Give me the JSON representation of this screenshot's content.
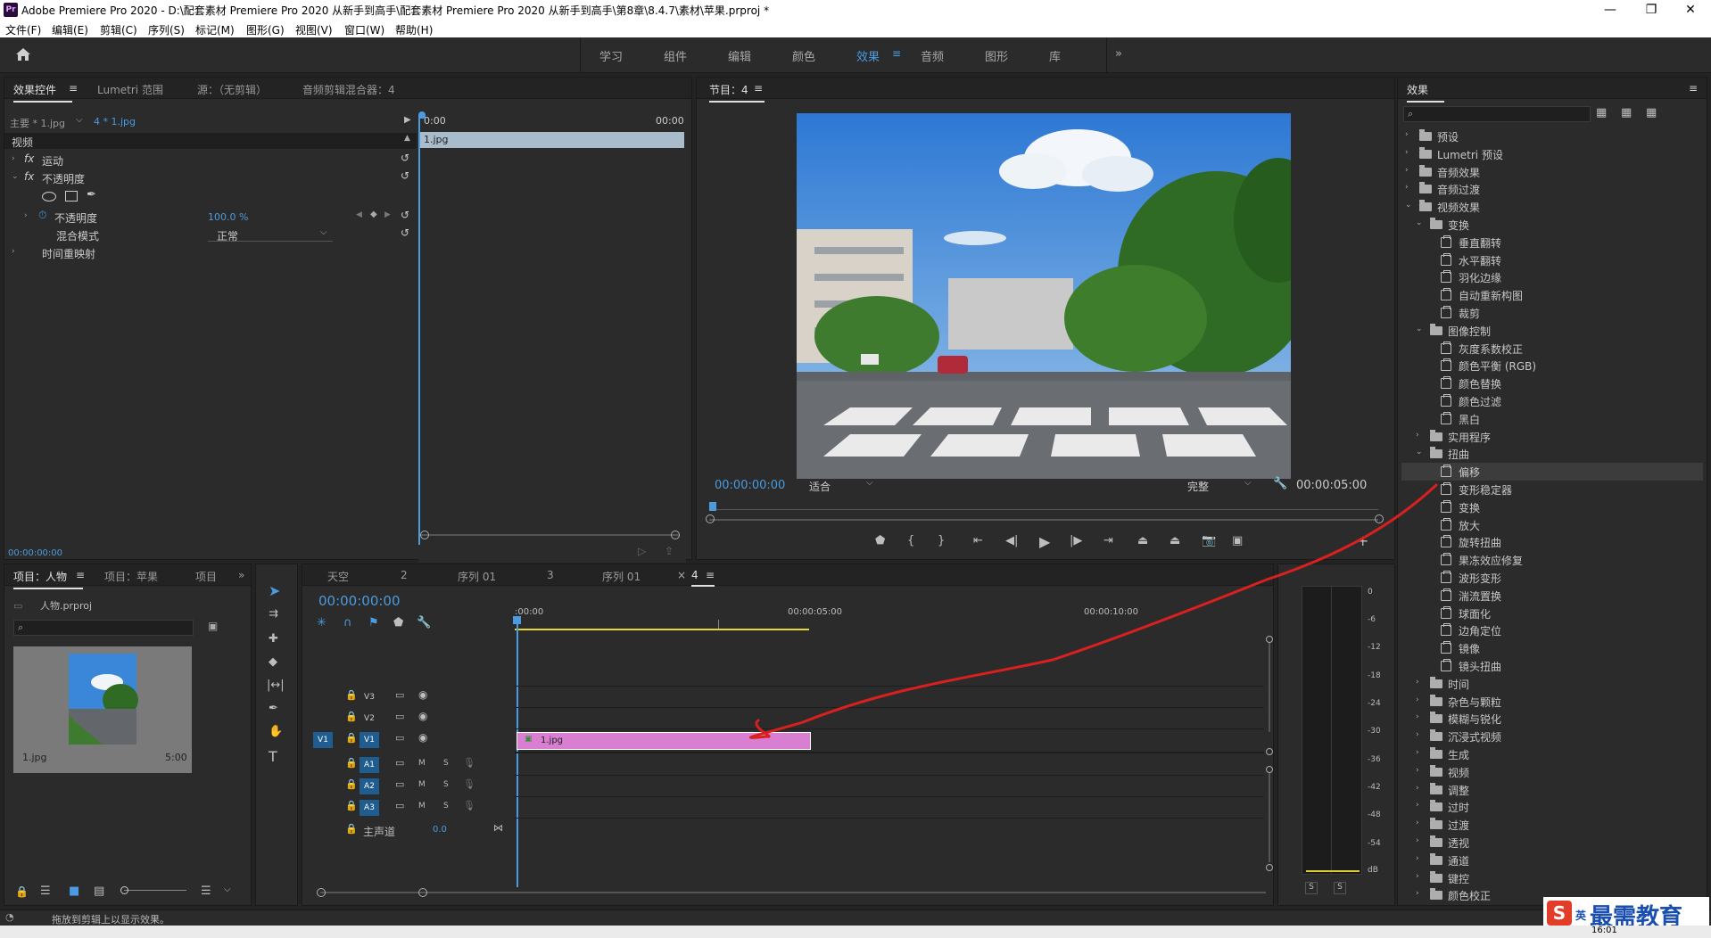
{
  "window": {
    "title": "Adobe Premiere Pro 2020 - D:\\配套素材 Premiere Pro 2020 从新手到高手\\配套素材 Premiere Pro 2020 从新手到高手\\第8章\\8.4.7\\素材\\苹果.prproj *",
    "app_badge": "Pr",
    "min": "—",
    "max": "❐",
    "close": "✕"
  },
  "menu": [
    "文件(F)",
    "编辑(E)",
    "剪辑(C)",
    "序列(S)",
    "标记(M)",
    "图形(G)",
    "视图(V)",
    "窗口(W)",
    "帮助(H)"
  ],
  "workspaces": {
    "items": [
      "学习",
      "组件",
      "编辑",
      "颜色",
      "效果",
      "音频",
      "图形",
      "库"
    ],
    "active": "效果",
    "more": "»"
  },
  "effect_controls": {
    "tabs": [
      "效果控件",
      "Lumetri 范围",
      "源：（无剪辑）",
      "音频剪辑混合器：4"
    ],
    "master": "主要 * 1.jpg",
    "clip": "4 * 1.jpg",
    "time_start": "0:00",
    "time_end": "00:00",
    "clip_name": "1.jpg",
    "section": "视频",
    "motion": "运动",
    "opacity": "不透明度",
    "opacity_prop": "不透明度",
    "opacity_value": "100.0 %",
    "blend_label": "混合模式",
    "blend_value": "正常",
    "time_remap": "时间重映射",
    "fx": "fx",
    "timecode": "00:00:00:00"
  },
  "program": {
    "title": "节目：4",
    "timecode": "00:00:00:00",
    "fit": "适合",
    "quality": "完整",
    "duration": "00:00:05:00"
  },
  "project": {
    "tabs": [
      "项目：人物",
      "项目：苹果",
      "项目"
    ],
    "file": "人物.prproj",
    "clip_name": "1.jpg",
    "clip_duration": "5:00"
  },
  "timeline": {
    "tabs": [
      "天空",
      "2",
      "序列 01",
      "3",
      "序列 01",
      "4"
    ],
    "timecode": "00:00:00:00",
    "ruler": [
      ":00:00",
      "00:00:05:00",
      "00:00:10:00"
    ],
    "video_tracks": [
      "V3",
      "V2",
      "V1"
    ],
    "audio_tracks": [
      "A1",
      "A2",
      "A3"
    ],
    "source_patch": "V1",
    "master": "主声道",
    "master_value": "0.0",
    "clip": "1.jpg",
    "m": "M",
    "s": "S"
  },
  "meter": {
    "scale": [
      "0",
      "-6",
      "-12",
      "-18",
      "-24",
      "-30",
      "-36",
      "-42",
      "-48",
      "-54",
      "dB"
    ],
    "solo": [
      "S",
      "S"
    ]
  },
  "effects_panel": {
    "title": "效果",
    "items": [
      {
        "label": "预设",
        "level": 0,
        "type": "folder",
        "open": false
      },
      {
        "label": "Lumetri 预设",
        "level": 0,
        "type": "folder",
        "open": false
      },
      {
        "label": "音频效果",
        "level": 0,
        "type": "folder",
        "open": false
      },
      {
        "label": "音频过渡",
        "level": 0,
        "type": "folder",
        "open": false
      },
      {
        "label": "视频效果",
        "level": 0,
        "type": "folder",
        "open": true
      },
      {
        "label": "变换",
        "level": 1,
        "type": "folder",
        "open": true
      },
      {
        "label": "垂直翻转",
        "level": 2,
        "type": "effect"
      },
      {
        "label": "水平翻转",
        "level": 2,
        "type": "effect"
      },
      {
        "label": "羽化边缘",
        "level": 2,
        "type": "effect"
      },
      {
        "label": "自动重新构图",
        "level": 2,
        "type": "effect"
      },
      {
        "label": "裁剪",
        "level": 2,
        "type": "effect"
      },
      {
        "label": "图像控制",
        "level": 1,
        "type": "folder",
        "open": true
      },
      {
        "label": "灰度系数校正",
        "level": 2,
        "type": "effect"
      },
      {
        "label": "颜色平衡 (RGB)",
        "level": 2,
        "type": "effect"
      },
      {
        "label": "颜色替换",
        "level": 2,
        "type": "effect"
      },
      {
        "label": "颜色过滤",
        "level": 2,
        "type": "effect"
      },
      {
        "label": "黑白",
        "level": 2,
        "type": "effect"
      },
      {
        "label": "实用程序",
        "level": 1,
        "type": "folder",
        "open": false
      },
      {
        "label": "扭曲",
        "level": 1,
        "type": "folder",
        "open": true
      },
      {
        "label": "偏移",
        "level": 2,
        "type": "effect",
        "selected": true
      },
      {
        "label": "变形稳定器",
        "level": 2,
        "type": "effect"
      },
      {
        "label": "变换",
        "level": 2,
        "type": "effect"
      },
      {
        "label": "放大",
        "level": 2,
        "type": "effect"
      },
      {
        "label": "旋转扭曲",
        "level": 2,
        "type": "effect"
      },
      {
        "label": "果冻效应修复",
        "level": 2,
        "type": "effect"
      },
      {
        "label": "波形变形",
        "level": 2,
        "type": "effect"
      },
      {
        "label": "湍流置换",
        "level": 2,
        "type": "effect"
      },
      {
        "label": "球面化",
        "level": 2,
        "type": "effect"
      },
      {
        "label": "边角定位",
        "level": 2,
        "type": "effect"
      },
      {
        "label": "镜像",
        "level": 2,
        "type": "effect"
      },
      {
        "label": "镜头扭曲",
        "level": 2,
        "type": "effect"
      },
      {
        "label": "时间",
        "level": 1,
        "type": "folder",
        "open": false
      },
      {
        "label": "杂色与颗粒",
        "level": 1,
        "type": "folder",
        "open": false
      },
      {
        "label": "模糊与锐化",
        "level": 1,
        "type": "folder",
        "open": false
      },
      {
        "label": "沉浸式视频",
        "level": 1,
        "type": "folder",
        "open": false
      },
      {
        "label": "生成",
        "level": 1,
        "type": "folder",
        "open": false
      },
      {
        "label": "视频",
        "level": 1,
        "type": "folder",
        "open": false
      },
      {
        "label": "调整",
        "level": 1,
        "type": "folder",
        "open": false
      },
      {
        "label": "过时",
        "level": 1,
        "type": "folder",
        "open": false
      },
      {
        "label": "过渡",
        "level": 1,
        "type": "folder",
        "open": false
      },
      {
        "label": "透视",
        "level": 1,
        "type": "folder",
        "open": false
      },
      {
        "label": "通道",
        "level": 1,
        "type": "folder",
        "open": false
      },
      {
        "label": "键控",
        "level": 1,
        "type": "folder",
        "open": false
      },
      {
        "label": "颜色校正",
        "level": 1,
        "type": "folder",
        "open": false
      }
    ]
  },
  "status": {
    "text": "拖放到剪辑上以显示效果。"
  },
  "watermark": {
    "logo": "S",
    "small": "英",
    "text": "最需教育"
  },
  "clock": "16:01"
}
